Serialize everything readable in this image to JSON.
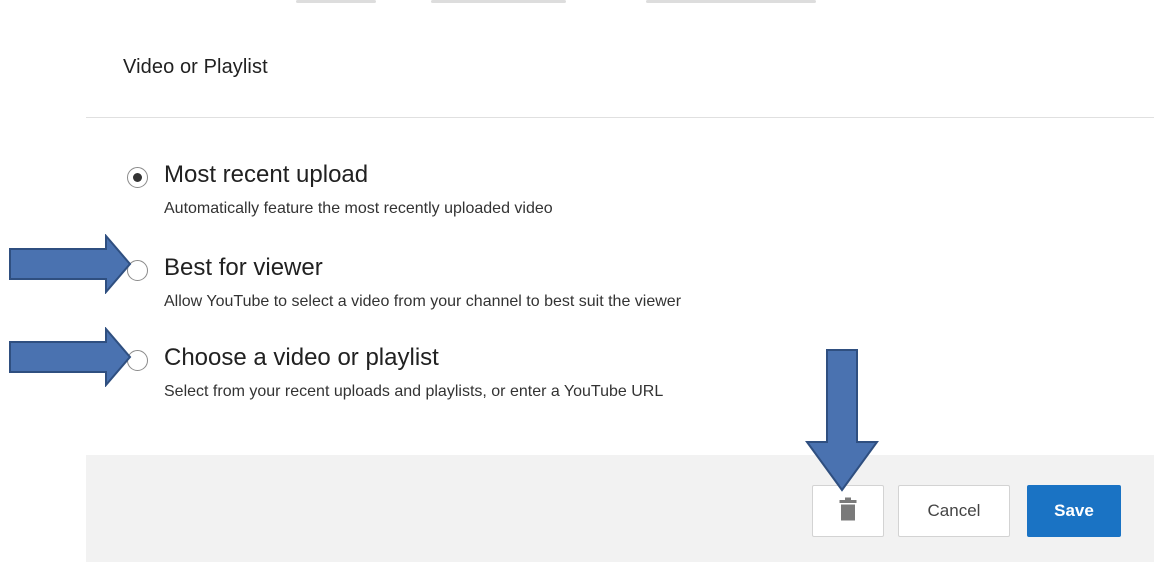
{
  "dialog": {
    "title": "Video or Playlist"
  },
  "options": [
    {
      "label": "Most recent upload",
      "description": "Automatically feature the most recently uploaded video",
      "selected": true
    },
    {
      "label": "Best for viewer",
      "description": "Allow YouTube to select a video from your channel to best suit the viewer",
      "selected": false
    },
    {
      "label": "Choose a video or playlist",
      "description": "Select from your recent uploads and playlists, or enter a YouTube URL",
      "selected": false
    }
  ],
  "footer": {
    "delete_icon": "trash-icon",
    "cancel_label": "Cancel",
    "save_label": "Save"
  },
  "annotations": {
    "arrow_color": "#4a72b0",
    "arrow_outline": "#2f4f80",
    "arrows": [
      {
        "points_to": "option-best-for-viewer",
        "direction": "right"
      },
      {
        "points_to": "option-choose-video-or-playlist",
        "direction": "right"
      },
      {
        "points_to": "delete-button",
        "direction": "down"
      }
    ]
  },
  "colors": {
    "save_button": "#1a73c4",
    "footer_background": "#f2f2f2"
  }
}
